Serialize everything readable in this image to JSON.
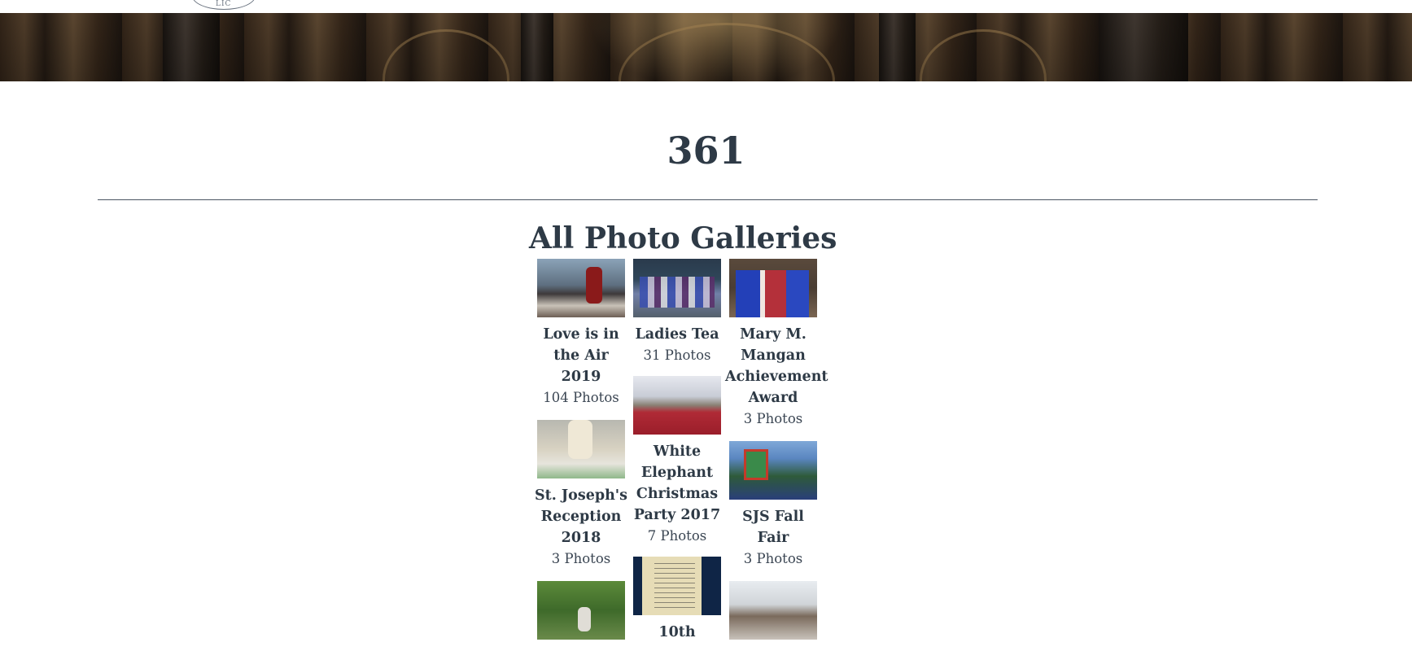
{
  "header": {
    "logo_text": "LIC"
  },
  "page": {
    "title": "361"
  },
  "gallery": {
    "heading": "All Photo Galleries",
    "columns": [
      [
        {
          "title": "Love is in the Air 2019",
          "count": "104 Photos"
        },
        {
          "title": "St. Joseph's Reception 2018",
          "count": "3 Photos"
        }
      ],
      [
        {
          "title": "Ladies Tea",
          "count": "31 Photos"
        },
        {
          "title": "White Elephant Christmas Party 2017",
          "count": "7 Photos"
        },
        {
          "title": "10th",
          "count": ""
        }
      ],
      [
        {
          "title": "Mary M. Mangan Achievement Award",
          "count": "3 Photos"
        },
        {
          "title": "SJS Fall Fair",
          "count": "3 Photos"
        }
      ]
    ]
  }
}
